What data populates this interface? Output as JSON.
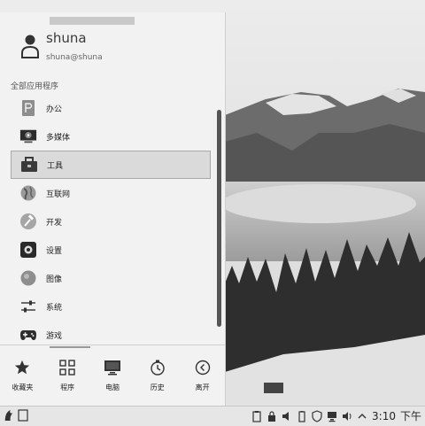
{
  "user": {
    "name": "shuna",
    "email": "shuna@shuna"
  },
  "menu": {
    "section_label": "全部应用程序",
    "categories": [
      {
        "label": "办公",
        "icon": "office-icon"
      },
      {
        "label": "多媒体",
        "icon": "multimedia-icon"
      },
      {
        "label": "工具",
        "icon": "toolbox-icon",
        "selected": true
      },
      {
        "label": "互联网",
        "icon": "internet-globe-icon"
      },
      {
        "label": "开发",
        "icon": "development-hammer-icon"
      },
      {
        "label": "设置",
        "icon": "settings-icon"
      },
      {
        "label": "图像",
        "icon": "graphics-icon"
      },
      {
        "label": "系统",
        "icon": "system-sliders-icon"
      },
      {
        "label": "游戏",
        "icon": "gamepad-icon"
      }
    ]
  },
  "bottom_bar": [
    {
      "label": "收藏夹",
      "icon": "star-icon"
    },
    {
      "label": "程序",
      "icon": "grid-icon"
    },
    {
      "label": "电脑",
      "icon": "monitor-icon"
    },
    {
      "label": "历史",
      "icon": "history-clock-icon"
    },
    {
      "label": "离开",
      "icon": "leave-arrow-icon"
    }
  ],
  "taskbar": {
    "time": "3:10",
    "ampm": "下午"
  },
  "colors": {
    "menu_bg": "#f2f2f2",
    "selected_bg": "#dadada",
    "taskbar_bg": "#e6e6e6"
  }
}
